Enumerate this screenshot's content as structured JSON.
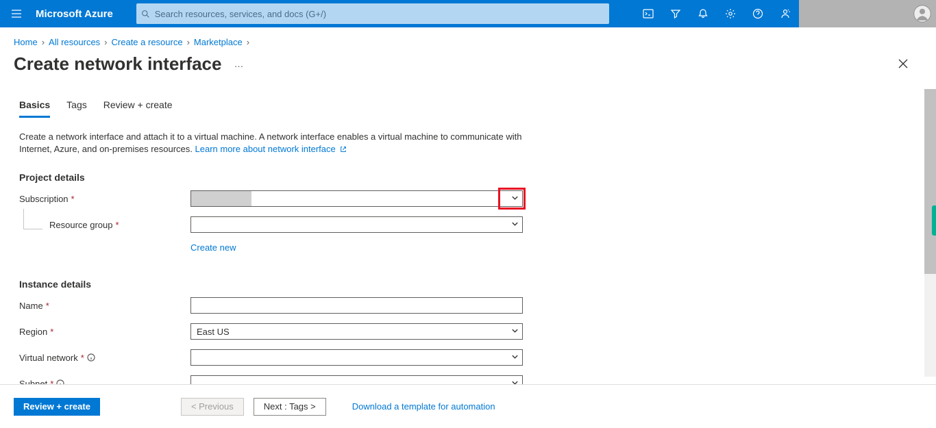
{
  "header": {
    "brand": "Microsoft Azure",
    "search_placeholder": "Search resources, services, and docs (G+/)"
  },
  "breadcrumb": {
    "items": [
      "Home",
      "All resources",
      "Create a resource",
      "Marketplace"
    ]
  },
  "page": {
    "title": "Create network interface",
    "more": "…"
  },
  "tabs": {
    "items": [
      {
        "label": "Basics",
        "active": true
      },
      {
        "label": "Tags",
        "active": false
      },
      {
        "label": "Review + create",
        "active": false
      }
    ]
  },
  "desc": {
    "text": "Create a network interface and attach it to a virtual machine. A network interface enables a virtual machine to communicate with Internet, Azure, and on-premises resources. ",
    "link": "Learn more about network interface"
  },
  "sections": {
    "project": {
      "heading": "Project details",
      "subscription_label": "Subscription",
      "subscription_value": "",
      "resource_group_label": "Resource group",
      "resource_group_value": "",
      "create_new": "Create new"
    },
    "instance": {
      "heading": "Instance details",
      "name_label": "Name",
      "name_value": "",
      "region_label": "Region",
      "region_value": "East US",
      "vnet_label": "Virtual network",
      "vnet_value": "",
      "subnet_label": "Subnet",
      "subnet_value": ""
    }
  },
  "footer": {
    "review": "Review + create",
    "prev": "< Previous",
    "next": "Next : Tags >",
    "download": "Download a template for automation"
  }
}
